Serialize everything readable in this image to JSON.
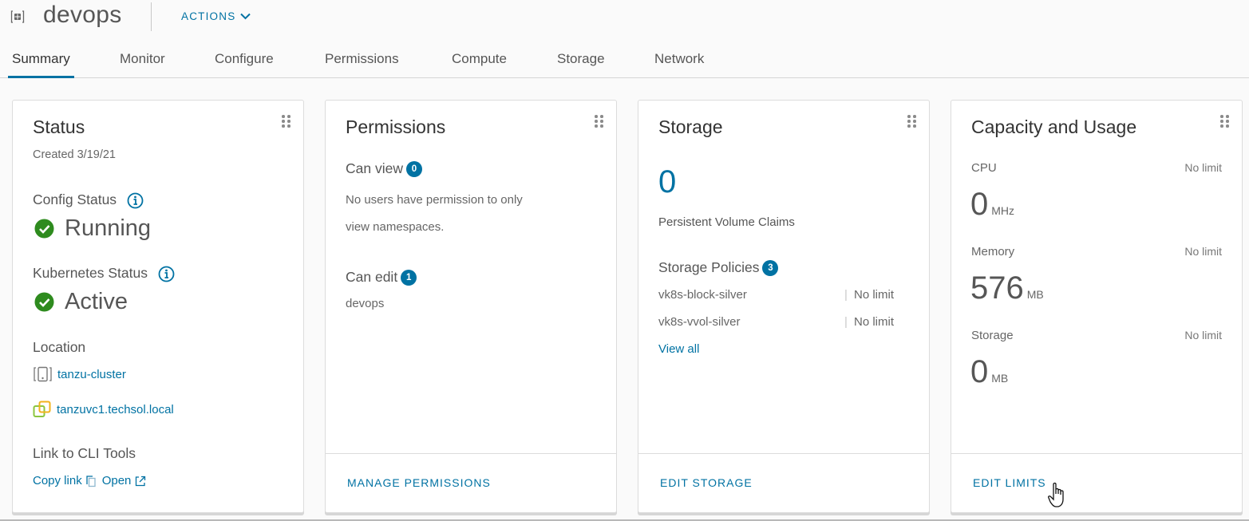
{
  "header": {
    "title": "devops",
    "actions_label": "ACTIONS",
    "icons": {
      "namespace": "namespace-icon",
      "actions_caret": "chevron-down-icon"
    }
  },
  "tabs": [
    {
      "label": "Summary",
      "active": true
    },
    {
      "label": "Monitor",
      "active": false
    },
    {
      "label": "Configure",
      "active": false
    },
    {
      "label": "Permissions",
      "active": false
    },
    {
      "label": "Compute",
      "active": false
    },
    {
      "label": "Storage",
      "active": false
    },
    {
      "label": "Network",
      "active": false
    }
  ],
  "status_card": {
    "title": "Status",
    "created": "Created 3/19/21",
    "config_status_label": "Config Status",
    "config_status_value": "Running",
    "k8s_status_label": "Kubernetes Status",
    "k8s_status_value": "Active",
    "location_label": "Location",
    "cluster": "tanzu-cluster",
    "vcenter": "tanzuvc1.techsol.local",
    "cli_label": "Link to CLI Tools",
    "copy_link": "Copy link",
    "open": "Open",
    "status_color": "#2e8b1e"
  },
  "permissions_card": {
    "title": "Permissions",
    "can_view_label": "Can view",
    "can_view_count": "0",
    "can_view_text": "No users have permission to only view namespaces.",
    "can_view_line1": "No users have permission to only",
    "can_view_line2": "view namespaces.",
    "can_edit_label": "Can edit",
    "can_edit_count": "1",
    "can_edit_users": [
      "devops"
    ],
    "footer": "MANAGE PERMISSIONS"
  },
  "storage_card": {
    "title": "Storage",
    "pvc_count": "0",
    "pvc_label": "Persistent Volume Claims",
    "policies_label": "Storage Policies",
    "policies_count": "3",
    "policies": [
      {
        "name": "vk8s-block-silver",
        "limit": "No limit"
      },
      {
        "name": "vk8s-vvol-silver",
        "limit": "No limit"
      }
    ],
    "view_all": "View all",
    "footer": "EDIT STORAGE"
  },
  "capacity_card": {
    "title": "Capacity and Usage",
    "items": [
      {
        "label": "CPU",
        "value": "0",
        "unit": "MHz",
        "limit": "No limit"
      },
      {
        "label": "Memory",
        "value": "576",
        "unit": "MB",
        "limit": "No limit"
      },
      {
        "label": "Storage",
        "value": "0",
        "unit": "MB",
        "limit": "No limit"
      }
    ],
    "footer": "EDIT LIMITS"
  },
  "colors": {
    "accent": "#0072a3",
    "success": "#2e8b1e"
  }
}
